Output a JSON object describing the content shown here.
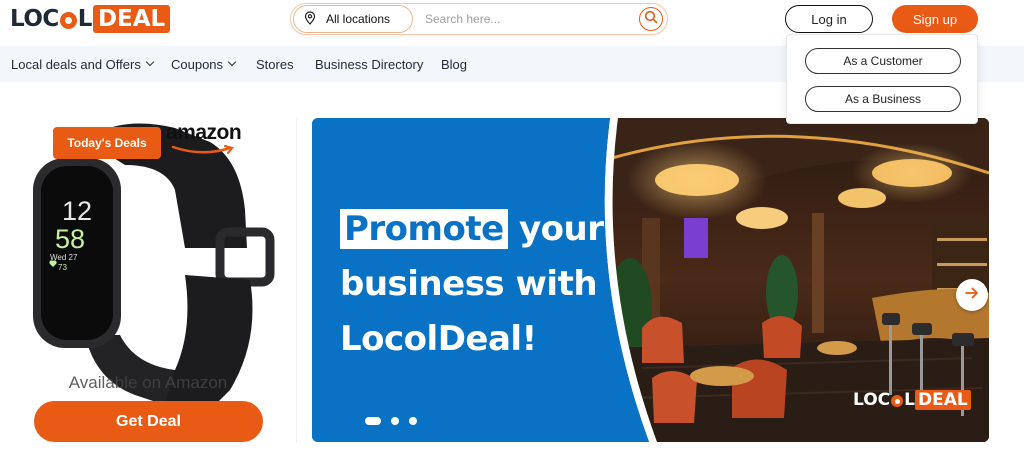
{
  "brand": {
    "logo_left": "LOC",
    "logo_after_ring": "L",
    "logo_deal": "DEAL",
    "accent_color": "#e95b14",
    "banner_blue": "#0a72c4"
  },
  "header": {
    "location_label": "All locations",
    "search_placeholder": "Search here...",
    "login_label": "Log in",
    "signup_label": "Sign up"
  },
  "login_dropdown": {
    "customer_label": "As a Customer",
    "business_label": "As a Business"
  },
  "nav": {
    "items": [
      {
        "label": "Local deals and Offers",
        "has_dropdown": true
      },
      {
        "label": "Coupons",
        "has_dropdown": true
      },
      {
        "label": "Stores",
        "has_dropdown": false
      },
      {
        "label": "Business Directory",
        "has_dropdown": false
      },
      {
        "label": "Blog",
        "has_dropdown": false
      }
    ]
  },
  "deal_card": {
    "badge": "Today's Deals",
    "brand_logo": "amazon",
    "watch_time_hour": "12",
    "watch_time_min": "58",
    "watch_date": "Wed 27",
    "watch_hr": "73",
    "availability": "Available on Amazon",
    "cta": "Get Deal"
  },
  "banner": {
    "headline_highlight": "Promote",
    "headline_line1_rest": " your",
    "headline_line2": "business with",
    "headline_line3": "LocolDeal!",
    "slide_count": 3,
    "active_slide": 1
  },
  "icons": {
    "location": "map-pin-icon",
    "search": "search-icon",
    "next": "arrow-right-icon"
  }
}
